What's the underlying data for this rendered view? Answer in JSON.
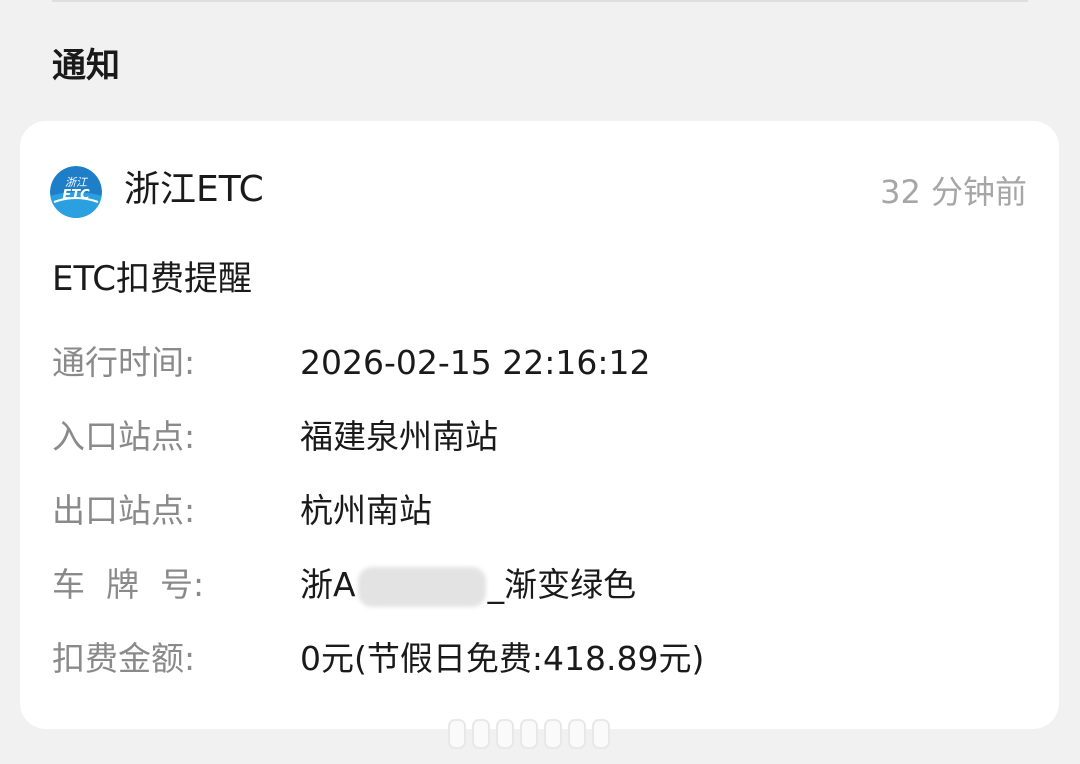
{
  "section": {
    "title": "通知"
  },
  "notification": {
    "app_icon": "zhejiang-etc-logo",
    "app_icon_text": "浙江",
    "app_icon_text2": "ETC",
    "app_name": "浙江ETC",
    "time_ago": "32 分钟前",
    "title": "ETC扣费提醒",
    "fields": [
      {
        "label": "通行时间:",
        "value": "2026-02-15 22:16:12"
      },
      {
        "label": "入口站点:",
        "value": "福建泉州南站"
      },
      {
        "label": "出口站点:",
        "value": "杭州南站"
      },
      {
        "label": "车  牌  号:",
        "value_prefix": "浙A",
        "value_suffix": "_渐变绿色"
      },
      {
        "label": "扣费金额:",
        "value": "0元(节假日免费:418.89元)"
      }
    ]
  },
  "colors": {
    "background": "#f1f1f1",
    "card": "#ffffff",
    "primary_text": "#1a1a1a",
    "secondary_text": "#8a8a8a",
    "timestamp": "#a6a6a6",
    "icon_blue": "#1e7fc8"
  }
}
